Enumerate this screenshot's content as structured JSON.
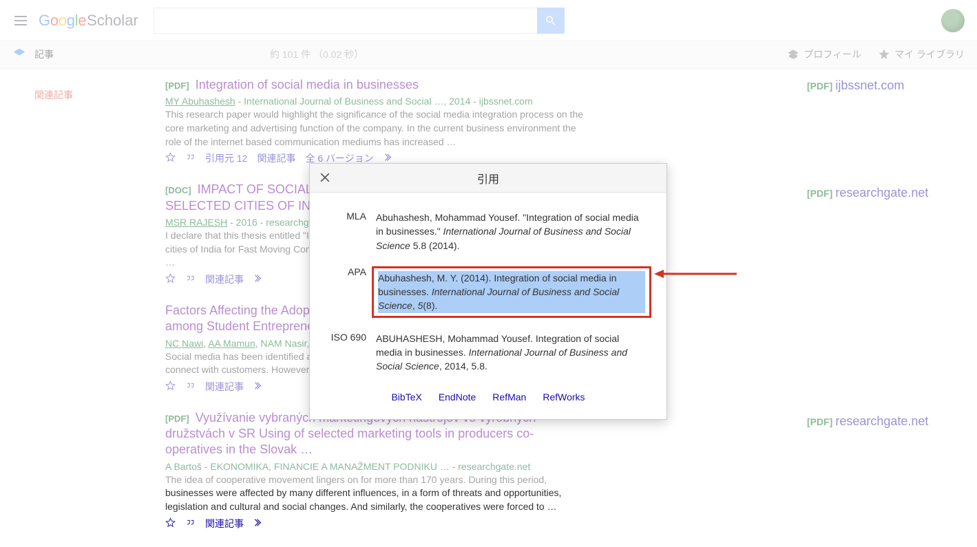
{
  "header": {
    "logo_scholar": "Scholar",
    "search_value": "",
    "search_placeholder": ""
  },
  "subbar": {
    "article_label": "記事",
    "results_count": "約 101 件 （0.02 秒）",
    "profile_label": "プロフィール",
    "library_label": "マイ ライブラリ"
  },
  "sidebar": {
    "related_label": "関連記事"
  },
  "results": [
    {
      "tag": "[PDF]",
      "title": "Integration of social media in businesses",
      "author": "MY Abuhashesh",
      "meta": " - International Journal of Business and Social …, 2014 - ijbssnet.com",
      "snippet": "This research paper would highlight the significance of the social media integration process on the core marketing and advertising function of the company. In the current business environment the role of the internet based communication mediums has increased …",
      "cited_by": "引用元 12",
      "related": "関連記事",
      "versions": "全 6 バージョン",
      "right_tag": "[PDF]",
      "right_domain": "ijbssnet.com"
    },
    {
      "tag": "[DOC]",
      "title": "IMPACT OF SOCIAL MEDIA MARKETING ON CONUSMERS IN SELECTED CITIES OF INDIA FOR FAST MOVING …",
      "author": "MSR RAJESH",
      "meta": " - 2016 - researchgate.net",
      "snippet": "I declare that this thesis entitled \"Impact of Social Media Marketing on Consumers in selected cities of India for Fast Moving Consumer Goods – Personal products\" is my own work conducted …",
      "related": "関連記事",
      "right_tag": "[PDF]",
      "right_domain": "researchgate.net"
    },
    {
      "tag": "",
      "title": "Factors Affecting the Adoption of Social Media as a Business Platform among Student Entrepreneurs …",
      "authors_html": "NC Nawi, AA Mamun, NAM Nasir, R…",
      "snippet": "Social media has been identified as a tool for marketing products and services, and to interact and connect with customers. However, the adoption of social media as a platform for …",
      "related": "関連記事"
    },
    {
      "tag": "[PDF]",
      "title": "Využívanie vybraných marketingových nástrojov vo výrobných družstvách v SR Using of selected marketing tools in producers co-operatives in the Slovak …",
      "author": "A Bartoš",
      "meta": " - EKONOMIKA, FINANCIE A MANAŽMENT PODNIKU … - researchgate.net",
      "snippet": "The idea of cooperative movement lingers on for more than 170 years. During this period, businesses were affected by many different influences, in a form of threats and opportunities, legislation and cultural and social changes. And similarly, the cooperatives were forced to …",
      "related": "関連記事",
      "right_tag": "[PDF]",
      "right_domain": "researchgate.net"
    }
  ],
  "modal": {
    "title": "引用",
    "rows": {
      "mla_label": "MLA",
      "mla_pre": "Abuhashesh, Mohammad Yousef. \"Integration of social media in businesses.\" ",
      "mla_it": "International Journal of Business and Social Science",
      "mla_post": " 5.8 (2014).",
      "apa_label": "APA",
      "apa_pre": "Abuhashesh, M. Y. (2014). Integration of social media in businesses. ",
      "apa_it": "International Journal of Business and Social Science",
      "apa_post": ", ",
      "apa_vol": "5",
      "apa_issue": "(8).",
      "iso_label": "ISO 690",
      "iso_pre": "ABUHASHESH, Mohammad Yousef. Integration of social media in businesses. ",
      "iso_it": "International Journal of Business and Social Science",
      "iso_post": ", 2014, 5.8."
    },
    "export": {
      "bibtex": "BibTeX",
      "endnote": "EndNote",
      "refman": "RefMan",
      "refworks": "RefWorks"
    }
  }
}
